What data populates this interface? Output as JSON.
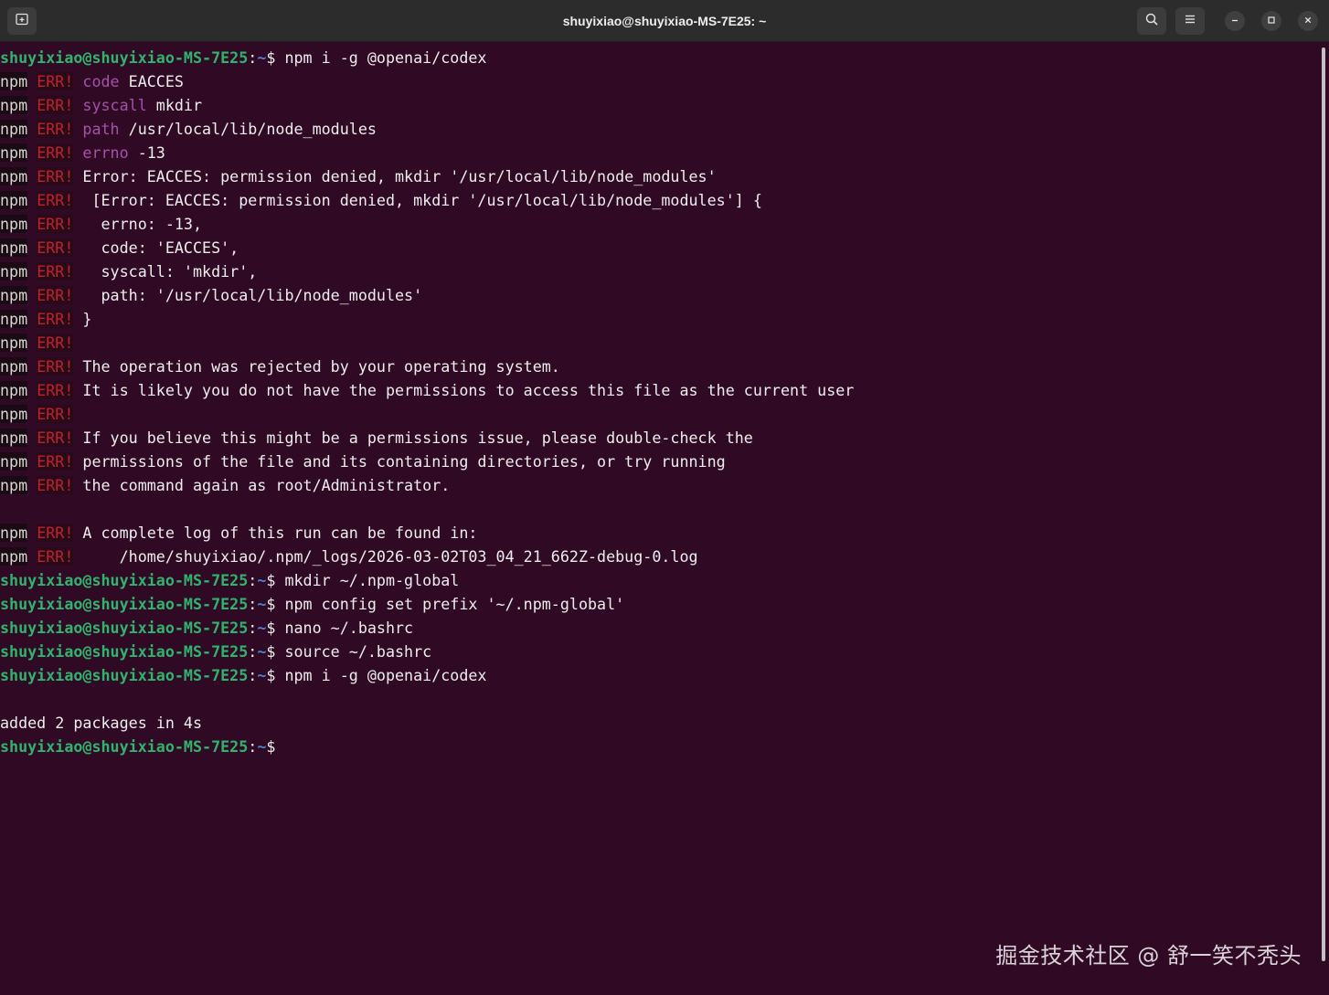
{
  "window": {
    "title": "shuyixiao@shuyixiao-MS-7E25: ~"
  },
  "icons": {
    "new_tab": "new-tab-icon",
    "search": "search-icon",
    "menu": "hamburger-menu-icon",
    "minimize": "minimize-icon",
    "maximize": "maximize-icon",
    "close": "close-icon"
  },
  "colors": {
    "background": "#300a24",
    "prompt_user": "#2fb46e",
    "prompt_path": "#4d83d0",
    "err": "#c0212d",
    "key": "#a551a8",
    "text": "#eeeeec"
  },
  "prompt": {
    "user": "shuyixiao@shuyixiao-MS-7E25",
    "sep": ":",
    "path": "~",
    "dollar": "$"
  },
  "npm_prefix": "npm",
  "err_tag": "ERR!",
  "lines": [
    {
      "kind": "prompt",
      "cmd": " npm i -g @openai/codex"
    },
    {
      "kind": "err",
      "key": "code",
      "text": " EACCES"
    },
    {
      "kind": "err",
      "key": "syscall",
      "text": " mkdir"
    },
    {
      "kind": "err",
      "key": "path",
      "text": " /usr/local/lib/node_modules"
    },
    {
      "kind": "err",
      "key": "errno",
      "text": " -13"
    },
    {
      "kind": "err",
      "key": "",
      "text": "Error: EACCES: permission denied, mkdir '/usr/local/lib/node_modules'"
    },
    {
      "kind": "err",
      "key": "",
      "text": " [Error: EACCES: permission denied, mkdir '/usr/local/lib/node_modules'] {"
    },
    {
      "kind": "err",
      "key": "",
      "text": "  errno: -13,"
    },
    {
      "kind": "err",
      "key": "",
      "text": "  code: 'EACCES',"
    },
    {
      "kind": "err",
      "key": "",
      "text": "  syscall: 'mkdir',"
    },
    {
      "kind": "err",
      "key": "",
      "text": "  path: '/usr/local/lib/node_modules'"
    },
    {
      "kind": "err",
      "key": "",
      "text": "}"
    },
    {
      "kind": "err",
      "key": "",
      "text": ""
    },
    {
      "kind": "err",
      "key": "",
      "text": "The operation was rejected by your operating system."
    },
    {
      "kind": "err",
      "key": "",
      "text": "It is likely you do not have the permissions to access this file as the current user"
    },
    {
      "kind": "err",
      "key": "",
      "text": ""
    },
    {
      "kind": "err",
      "key": "",
      "text": "If you believe this might be a permissions issue, please double-check the"
    },
    {
      "kind": "err",
      "key": "",
      "text": "permissions of the file and its containing directories, or try running"
    },
    {
      "kind": "err",
      "key": "",
      "text": "the command again as root/Administrator."
    },
    {
      "kind": "blank",
      "text": ""
    },
    {
      "kind": "err",
      "key": "",
      "text": "A complete log of this run can be found in:"
    },
    {
      "kind": "err",
      "key": "",
      "text": "    /home/shuyixiao/.npm/_logs/2026-03-02T03_04_21_662Z-debug-0.log"
    },
    {
      "kind": "prompt",
      "cmd": " mkdir ~/.npm-global"
    },
    {
      "kind": "prompt",
      "cmd": " npm config set prefix '~/.npm-global'"
    },
    {
      "kind": "prompt",
      "cmd": " nano ~/.bashrc"
    },
    {
      "kind": "prompt",
      "cmd": " source ~/.bashrc"
    },
    {
      "kind": "prompt",
      "cmd": " npm i -g @openai/codex"
    },
    {
      "kind": "blank",
      "text": ""
    },
    {
      "kind": "plain",
      "text": "added 2 packages in 4s"
    },
    {
      "kind": "prompt",
      "cmd": ""
    }
  ],
  "watermark": "掘金技术社区 @ 舒一笑不秃头"
}
